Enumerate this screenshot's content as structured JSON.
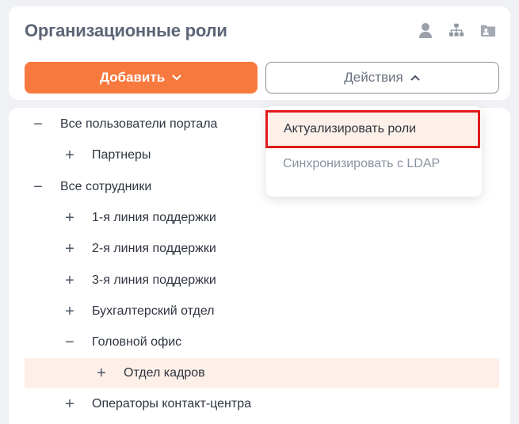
{
  "header": {
    "title": "Организационные роли",
    "icons": [
      "user-icon",
      "org-structure-icon",
      "folder-user-icon"
    ],
    "icon_color": "#9aa1ab"
  },
  "toolbar": {
    "add_label": "Добавить",
    "actions_label": "Действия",
    "accent_color": "#f8793d"
  },
  "dropdown": {
    "items": [
      {
        "label": "Актуализировать роли",
        "highlighted": true
      },
      {
        "label": "Синхронизировать с LDAP",
        "highlighted": false
      }
    ]
  },
  "tree": {
    "rows": [
      {
        "toggle": "−",
        "label": "Все пользователи портала"
      },
      {
        "toggle": "+",
        "label": "Партнеры"
      },
      {
        "toggle": "−",
        "label": "Все сотрудники"
      },
      {
        "toggle": "+",
        "label": "1-я линия поддержки"
      },
      {
        "toggle": "+",
        "label": "2-я линия поддержки"
      },
      {
        "toggle": "+",
        "label": "3-я линия поддержки"
      },
      {
        "toggle": "+",
        "label": "Бухгалтерский отдел"
      },
      {
        "toggle": "−",
        "label": "Головной офис"
      },
      {
        "toggle": "+",
        "label": "Отдел кадров",
        "selected": true
      },
      {
        "toggle": "+",
        "label": "Операторы контакт-центра"
      }
    ]
  }
}
